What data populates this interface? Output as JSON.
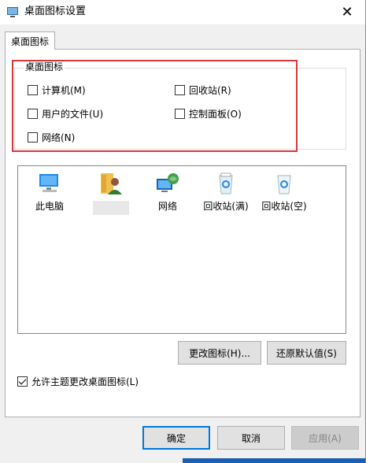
{
  "window": {
    "title": "桌面图标设置",
    "close": "✕"
  },
  "tabs": [
    {
      "label": "桌面图标"
    }
  ],
  "group": {
    "label": "桌面图标",
    "checkboxes": [
      {
        "label": "计算机(M)",
        "checked": false
      },
      {
        "label": "回收站(R)",
        "checked": false
      },
      {
        "label": "用户的文件(U)",
        "checked": false
      },
      {
        "label": "控制面板(O)",
        "checked": false
      },
      {
        "label": "网络(N)",
        "checked": false
      }
    ]
  },
  "icon_list": [
    {
      "label": "此电脑",
      "icon": "computer-icon"
    },
    {
      "label": "",
      "icon": "user-folder-icon"
    },
    {
      "label": "网络",
      "icon": "network-icon"
    },
    {
      "label": "回收站(满)",
      "icon": "recycle-bin-full-icon"
    },
    {
      "label": "回收站(空)",
      "icon": "recycle-bin-empty-icon"
    }
  ],
  "buttons": {
    "change_icon": "更改图标(H)...",
    "restore_default": "还原默认值(S)",
    "ok": "确定",
    "cancel": "取消",
    "apply": "应用(A)"
  },
  "allow_themes": {
    "label": "允许主题更改桌面图标(L)",
    "checked": true
  },
  "colors": {
    "highlight": "#d6383a",
    "accent": "#0078d7"
  }
}
